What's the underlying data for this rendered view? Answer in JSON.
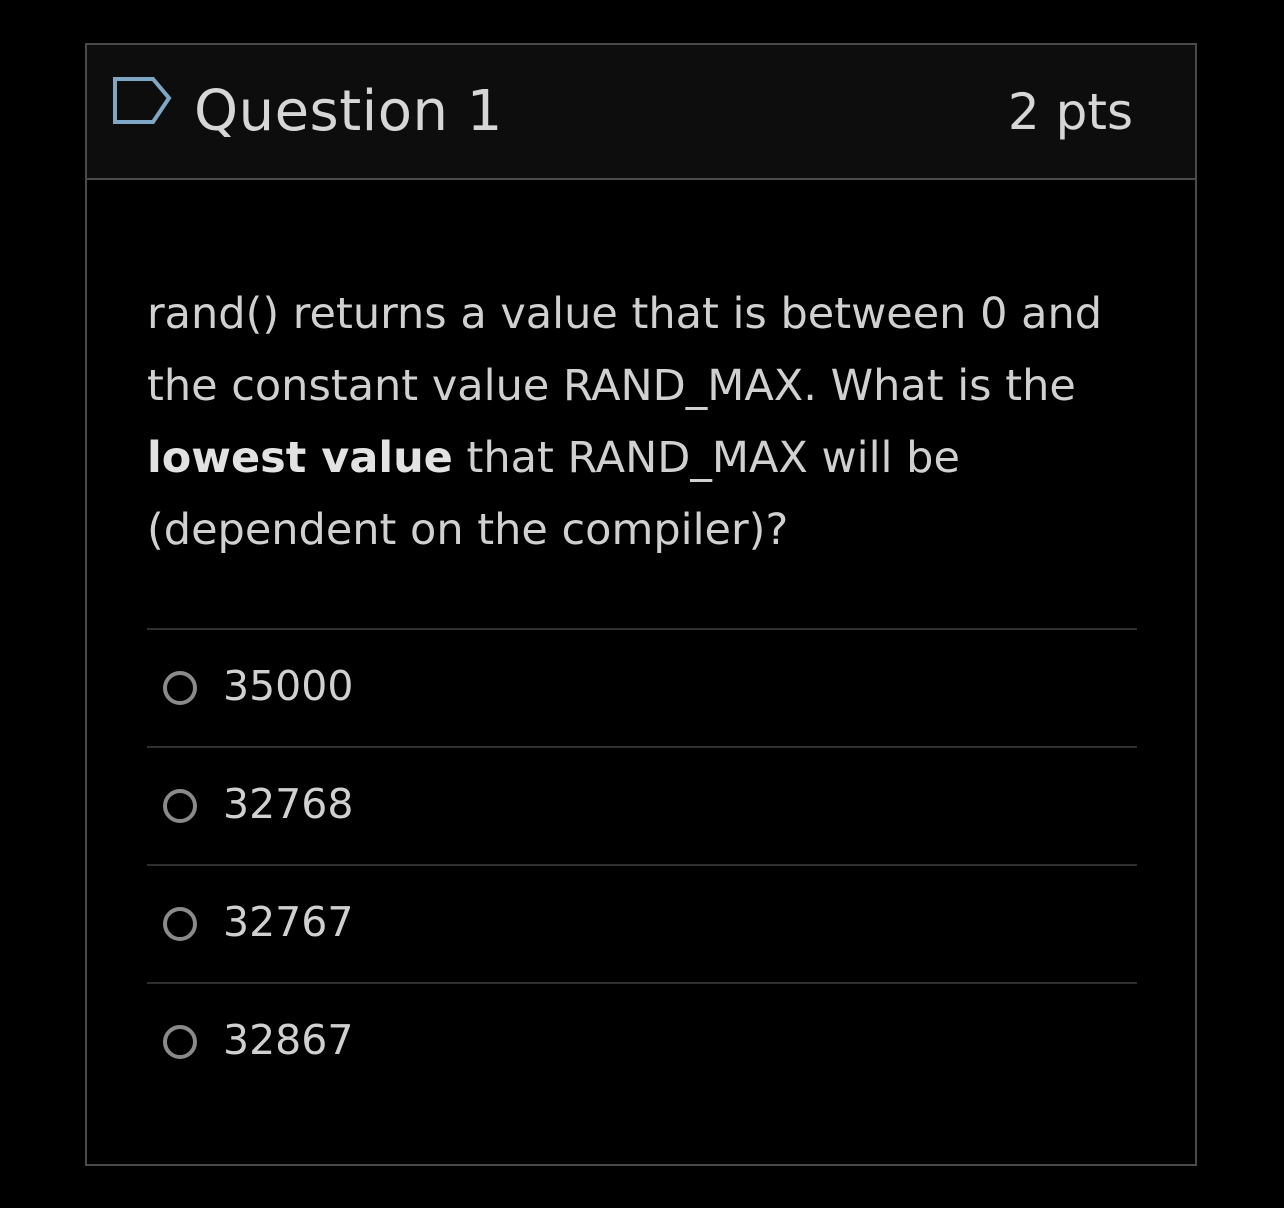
{
  "question": {
    "title": "Question 1",
    "points": "2 pts",
    "text_part1": "rand() returns a value that is between 0 and the constant value RAND_MAX.  What is the ",
    "text_bold": "lowest value",
    "text_part2": " that RAND_MAX will be (dependent on the compiler)?",
    "flag_icon": "flag-icon"
  },
  "answers": [
    {
      "label": "35000",
      "selected": false
    },
    {
      "label": "32768",
      "selected": false
    },
    {
      "label": "32767",
      "selected": false
    },
    {
      "label": "32867",
      "selected": false
    }
  ],
  "colors": {
    "background": "#000000",
    "header_background": "#0d0d0d",
    "border": "#4a4a4a",
    "text": "#d0d0d0",
    "flag_stroke": "#7fa7c4",
    "radio_border": "#8a8a8a"
  }
}
